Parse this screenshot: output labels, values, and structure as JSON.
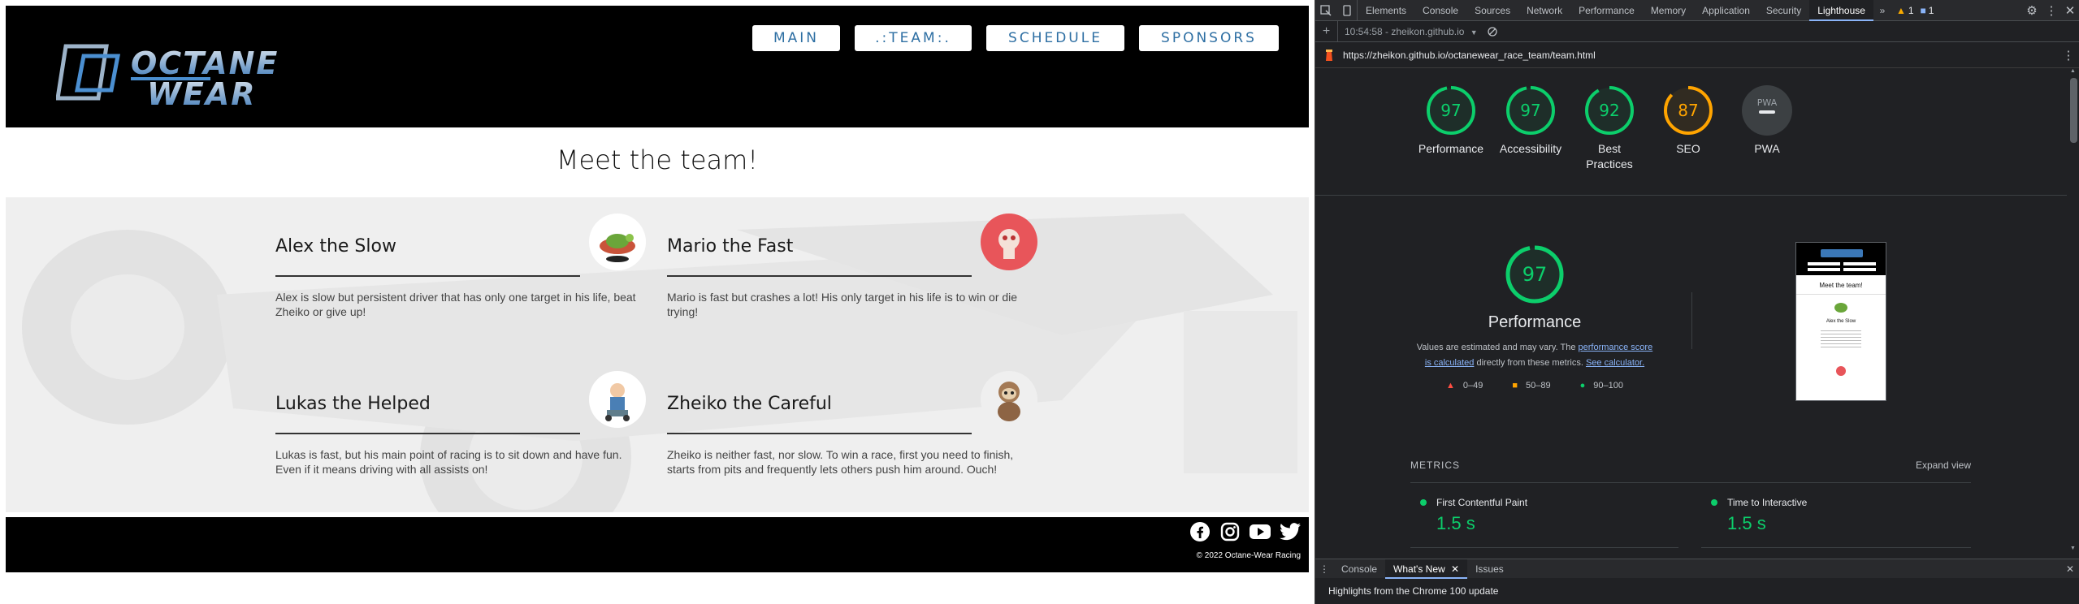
{
  "site": {
    "nav": [
      {
        "label": "MAIN"
      },
      {
        "label": ".:TEAM:."
      },
      {
        "label": "SCHEDULE"
      },
      {
        "label": "SPONSORS"
      }
    ],
    "heading": "Meet the team!",
    "members": [
      {
        "name": "Alex the Slow",
        "description": "Alex is slow but persistent driver that has only one target in his life, beat Zheiko or give up!"
      },
      {
        "name": "Mario the Fast",
        "description": "Mario is fast but crashes a lot! His only target in his life is to win or die trying!"
      },
      {
        "name": "Lukas the Helped",
        "description": "Lukas is fast, but his main point of racing is to sit down and have fun. Even if it means driving with all assists on!"
      },
      {
        "name": "Zheiko the Careful",
        "description": "Zheiko is neither fast, nor slow. To win a race, first you need to finish, starts from pits and frequently lets others push him around. Ouch!"
      }
    ],
    "footer": {
      "copyright": "© 2022 Octane-Wear Racing"
    },
    "logo_text": [
      "OCTANE",
      "WEAR"
    ]
  },
  "devtools": {
    "tabs": [
      "Elements",
      "Console",
      "Sources",
      "Network",
      "Performance",
      "Memory",
      "Application",
      "Security",
      "Lighthouse"
    ],
    "active_tab": "Lighthouse",
    "warnings": "1",
    "messages": "1",
    "report_select": "10:54:58 - zheikon.github.io",
    "url": "https://zheikon.github.io/octanewear_race_team/team.html",
    "categories": [
      {
        "label": "Performance",
        "score": "97",
        "color": "#0cce6b"
      },
      {
        "label": "Accessibility",
        "score": "97",
        "color": "#0cce6b"
      },
      {
        "label": "Best Practices",
        "score": "92",
        "color": "#0cce6b"
      },
      {
        "label": "SEO",
        "score": "87",
        "color": "#ffa400"
      },
      {
        "label": "PWA",
        "score": "PWA",
        "color": "#9aa0a6"
      }
    ],
    "perf": {
      "score": "97",
      "title": "Performance",
      "note_start": "Values are estimated and may vary. The ",
      "note_link1": "performance score is calculated",
      "note_mid": " directly from these metrics. ",
      "note_link2": "See calculator.",
      "legend": [
        {
          "range": "0–49",
          "color": "#ff4e42"
        },
        {
          "range": "50–89",
          "color": "#ffa400"
        },
        {
          "range": "90–100",
          "color": "#0cce6b"
        }
      ]
    },
    "preview": {
      "heading": "Meet the team!",
      "member": "Alex the Slow"
    },
    "metrics_header": "METRICS",
    "expand_view": "Expand view",
    "metrics": [
      {
        "title": "First Contentful Paint",
        "value": "1.5 s"
      },
      {
        "title": "Time to Interactive",
        "value": "1.5 s"
      }
    ],
    "drawer_tabs": [
      "Console",
      "What's New",
      "Issues"
    ],
    "drawer_active": "What's New",
    "drawer_text": "Highlights from the Chrome 100 update"
  }
}
